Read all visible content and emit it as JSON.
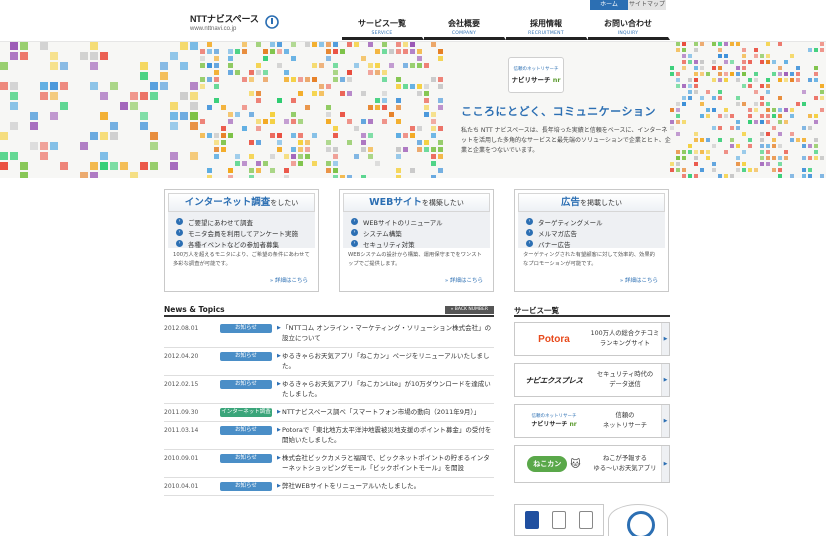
{
  "util": {
    "home": "ホーム",
    "sitemap": "サイトマップ"
  },
  "logo": {
    "name": "NTTナビスペース",
    "url": "www.nttnavi.co.jp"
  },
  "nav": [
    {
      "jp": "サービス一覧",
      "en": "SERVICE"
    },
    {
      "jp": "会社概要",
      "en": "COMPANY"
    },
    {
      "jp": "採用情報",
      "en": "RECRUITMENT"
    },
    {
      "jp": "お問い合わせ",
      "en": "INQUIRY"
    }
  ],
  "hero": {
    "badge_small": "信頼のネットリサーチ",
    "badge_big": "ナビリサーチ",
    "badge_mark": "nr",
    "title": "こころにとどく、コミュニケーション",
    "text": "私たち NTT ナビスペースは、長年培った実績と信頼をベースに、インターネットを活用した多角的なサービスと最先端のソリューションで企業とヒト、企業と企業をつないでいます。"
  },
  "services": [
    {
      "head_bold": "インターネット調査",
      "head_rest": "をしたい",
      "items": [
        "ご要望にあわせて調査",
        "モニタ会員を利用してアンケート実施",
        "各種イベントなどの参加者募集"
      ],
      "desc": "100万人を超えるモニタにより、ご希望の条件にあわせて多彩な調査が可能です。",
      "more": "詳細はこちら"
    },
    {
      "head_bold": "WEBサイト",
      "head_rest": "を構築したい",
      "items": [
        "WEBサイトのリニューアル",
        "システム構築",
        "セキュリティ対策"
      ],
      "desc": "WEBシステムの設計から構築、運用保守までをワンストップでご提供します。",
      "more": "詳細はこちら"
    },
    {
      "head_bold": "広告",
      "head_rest": "を掲載したい",
      "items": [
        "ターゲティングメール",
        "メルマガ広告",
        "バナー広告"
      ],
      "desc": "ターゲティングされた有望顧客に対して効率的、効果的なプロモーションが可能です。",
      "more": "詳細はこちら"
    }
  ],
  "news": {
    "title": "News & Topics",
    "back": "BACK NUMBER",
    "items": [
      {
        "date": "2012.08.01",
        "cat": "お知らせ",
        "text": "「NTTコム オンライン・マーケティング・ソリューション株式会社」の設立について"
      },
      {
        "date": "2012.04.20",
        "cat": "お知らせ",
        "text": "ゆるきゃらお天気アプリ「ねこカン」ページをリニューアルいたしました。"
      },
      {
        "date": "2012.02.15",
        "cat": "お知らせ",
        "text": "ゆるきゃらお天気アプリ「ねこカンLite」が10万ダウンロードを達成いたしました。"
      },
      {
        "date": "2011.09.30",
        "cat": "インターネット調査",
        "text": "NTTナビスペース調べ「スマートフォン市場の動向（2011年9月）」"
      },
      {
        "date": "2011.03.14",
        "cat": "お知らせ",
        "text": "Potoraで「東北地方太平洋沖地震被災地支援のポイント募金」の受付を開始いたしました。"
      },
      {
        "date": "2010.09.01",
        "cat": "お知らせ",
        "text": "株式会社ビックカメラと福岡で、ビックネットポイントの貯まるインターネットショッピングモール「ビックポイントモール」を開設"
      },
      {
        "date": "2010.04.01",
        "cat": "お知らせ",
        "text": "弊社WEBサイトをリニューアルいたしました。"
      }
    ]
  },
  "side": {
    "title": "サービス一覧",
    "items": [
      {
        "logo": "Potora",
        "text1": "100万人の総合クチコミ",
        "text2": "ランキングサイト"
      },
      {
        "logo": "ナビエクスプレス",
        "text1": "セキュリティ時代の",
        "text2": "データ送信"
      },
      {
        "logo": "ナビリサーチ",
        "logo_small": "信頼のネットリサーチ",
        "text1": "信頼の",
        "text2": "ネットリサーチ"
      },
      {
        "logo": "ねこカン",
        "text1": "ねこが予報する",
        "text2": "ゆる〜いお天気アプリ"
      }
    ]
  },
  "colors": {
    "accent": "#2c6fb3",
    "news_green": "#3aa57a"
  }
}
